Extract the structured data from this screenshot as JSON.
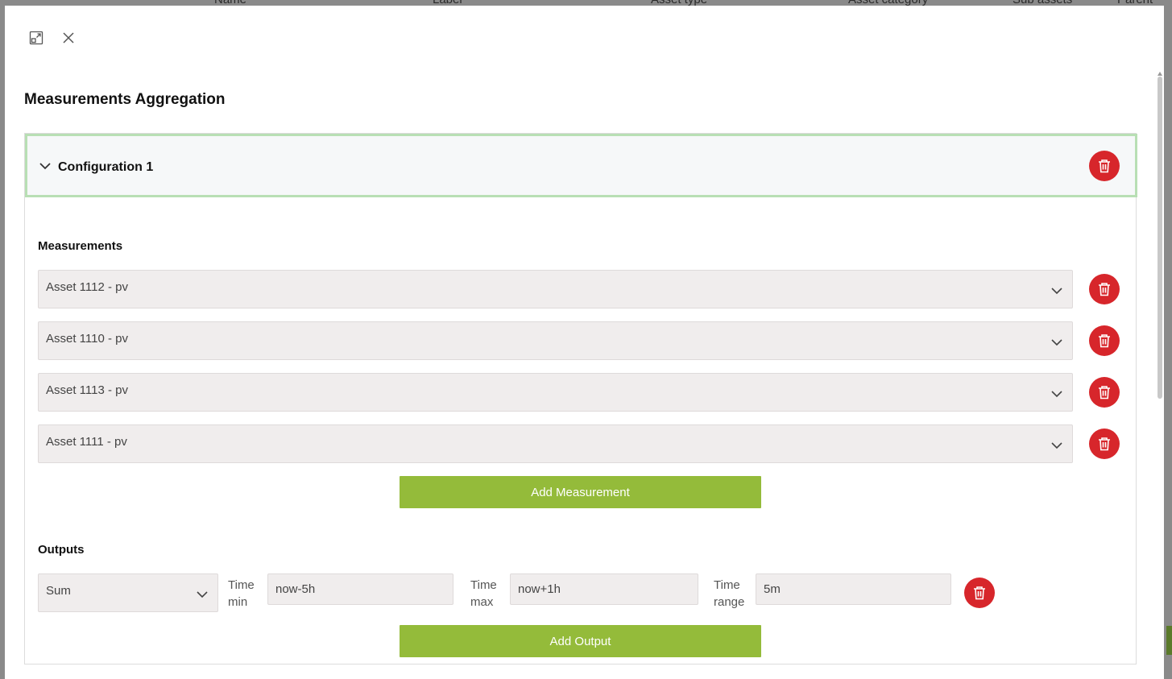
{
  "background": {
    "columns": [
      "Name",
      "Label",
      "Asset type",
      "Asset category",
      "Sub assets",
      "Parent"
    ]
  },
  "modal": {
    "title": "Measurements Aggregation",
    "configuration": {
      "title": "Configuration 1",
      "measurements_label": "Measurements",
      "measurements": [
        {
          "value": "Asset 1112 - pv"
        },
        {
          "value": "Asset 1110 - pv"
        },
        {
          "value": "Asset 1113 - pv"
        },
        {
          "value": "Asset 1111 - pv"
        }
      ],
      "add_measurement_label": "Add Measurement",
      "outputs_label": "Outputs",
      "output": {
        "aggregation": "Sum",
        "time_min_label_1": "Time",
        "time_min_label_2": "min",
        "time_min": "now-5h",
        "time_max_label_1": "Time",
        "time_max_label_2": "max",
        "time_max": "now+1h",
        "time_range_label_1": "Time",
        "time_range_label_2": "range",
        "time_range": "5m"
      },
      "add_output_label": "Add Output"
    }
  },
  "colors": {
    "delete": "#d7262b",
    "primary_green": "#94bb3a",
    "header_border": "#b8dfb4",
    "field_bg": "#f0eded"
  },
  "icons": {
    "expand": "expand-icon",
    "close": "close-icon",
    "chevron": "chevron-down-icon",
    "trash": "trash-icon"
  }
}
